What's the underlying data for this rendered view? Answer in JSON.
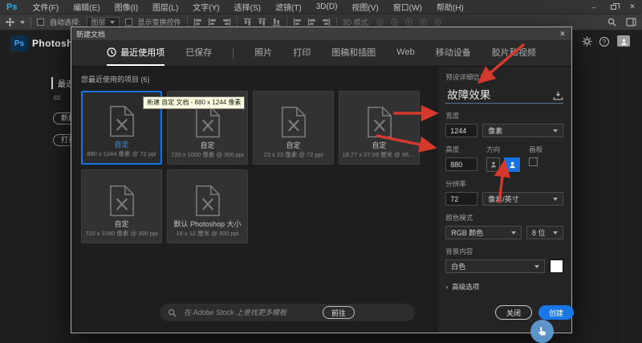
{
  "menu_bar": {
    "logo": "Ps",
    "items": [
      "文件(F)",
      "编辑(E)",
      "图像(I)",
      "图层(L)",
      "文字(Y)",
      "选择(S)",
      "滤镜(T)",
      "3D(D)",
      "视图(V)",
      "窗口(W)",
      "帮助(H)"
    ],
    "minimize": "–",
    "close": "✕"
  },
  "options_bar": {
    "auto_select": "自动选择:",
    "layer_select": "图层",
    "show_transform": "显示变换控件",
    "mode_3d": "3D 模式:"
  },
  "home": {
    "logo": "Ps",
    "app_name": "Photoshop",
    "nav_recent_clipped": "最近使用项",
    "cc": "cc",
    "new_clipped": "新建",
    "open_clipped": "打开",
    "help": "?"
  },
  "dialog": {
    "title": "新建文档",
    "close_x": "✕",
    "tabs": [
      {
        "label": "最近使用项",
        "active": true
      },
      {
        "label": "已保存"
      },
      {
        "label": "照片"
      },
      {
        "label": "打印"
      },
      {
        "label": "图稿和插图"
      },
      {
        "label": "Web"
      },
      {
        "label": "移动设备"
      },
      {
        "label": "胶片和视频"
      }
    ],
    "recent_header": "您最近使用的项目 (6)",
    "tooltip": "新建 自定 文档 - 880 x 1244 像素",
    "presets": [
      {
        "name": "自定",
        "spec": "880 x 1244 像素 @ 72 ppi",
        "selected": true
      },
      {
        "name": "自定",
        "spec": "720 x 1000 像素 @ 300 ppi"
      },
      {
        "name": "自定",
        "spec": "23 x 23 像素 @ 72 ppi"
      },
      {
        "name": "自定",
        "spec": "18.77 x 27.09 厘米 @ 96.012…"
      },
      {
        "name": "自定",
        "spec": "720 x 1080 像素 @ 300 ppi"
      },
      {
        "name": "默认 Photoshop 大小",
        "spec": "16 x 12 厘米 @ 300 ppi"
      }
    ],
    "search": {
      "placeholder": "在 Adobe Stock 上查找更多模板",
      "go": "前往"
    },
    "details": {
      "header": "预设详细信息",
      "doc_name": "故障效果",
      "width_label": "宽度",
      "width_value": "1244",
      "width_unit": "像素",
      "height_label": "高度",
      "height_value": "880",
      "orientation_label": "方向",
      "artboard_label": "画板",
      "resolution_label": "分辨率",
      "resolution_value": "72",
      "resolution_unit": "像素/英寸",
      "color_mode_label": "颜色模式",
      "color_mode": "RGB 颜色",
      "bit_depth": "8 位",
      "background_label": "背景内容",
      "background_value": "白色",
      "advanced_label": "高级选项"
    },
    "footer": {
      "close": "关闭",
      "create": "创建"
    }
  },
  "colors": {
    "accent_blue": "#1473e6",
    "arrow_red": "#d6382c",
    "tooltip_bg": "#ffffe1",
    "background_swatch": "#ffffff"
  }
}
